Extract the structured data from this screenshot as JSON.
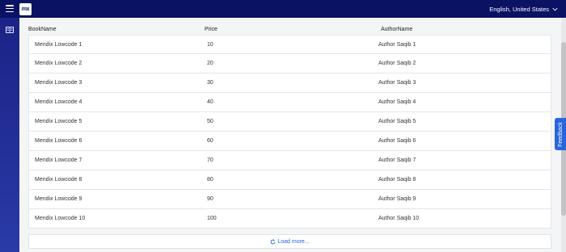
{
  "topbar": {
    "logo_text": "mx",
    "language": "English, United States"
  },
  "icons": {
    "menu": "hamburger-menu-icon",
    "sidebar": "book-list-icon",
    "dropdown": "chevron-down-icon",
    "refresh": "refresh-icon"
  },
  "table": {
    "headers": [
      "BookName",
      "Price",
      "AuthorName"
    ],
    "rows": [
      [
        "Mendix Lowcode 1",
        "10",
        "Author Saqib 1"
      ],
      [
        "Mendix Lowcode 2",
        "20",
        "Author Saqib 2"
      ],
      [
        "Mendix Lowcode 3",
        "30",
        "Author Saqib 3"
      ],
      [
        "Mendix Lowcode 4",
        "40",
        "Author Saqib 4"
      ],
      [
        "Mendix Lowcode 5",
        "50",
        "Author Saqib 5"
      ],
      [
        "Mendix Lowcode 6",
        "60",
        "Author Saqib 6"
      ],
      [
        "Mendix Lowcode 7",
        "70",
        "Author Saqib 7"
      ],
      [
        "Mendix Lowcode 8",
        "80",
        "Author Saqib 8"
      ],
      [
        "Mendix Lowcode 9",
        "90",
        "Author Saqib 9"
      ],
      [
        "Mendix Lowcode 10",
        "100",
        "Author Saqib 10"
      ]
    ]
  },
  "load_more_label": "Load more...",
  "feedback_label": "Feedback",
  "colors": {
    "topbar": "#0a1264",
    "sidebar": "#1b2386",
    "accent": "#2864dc"
  }
}
